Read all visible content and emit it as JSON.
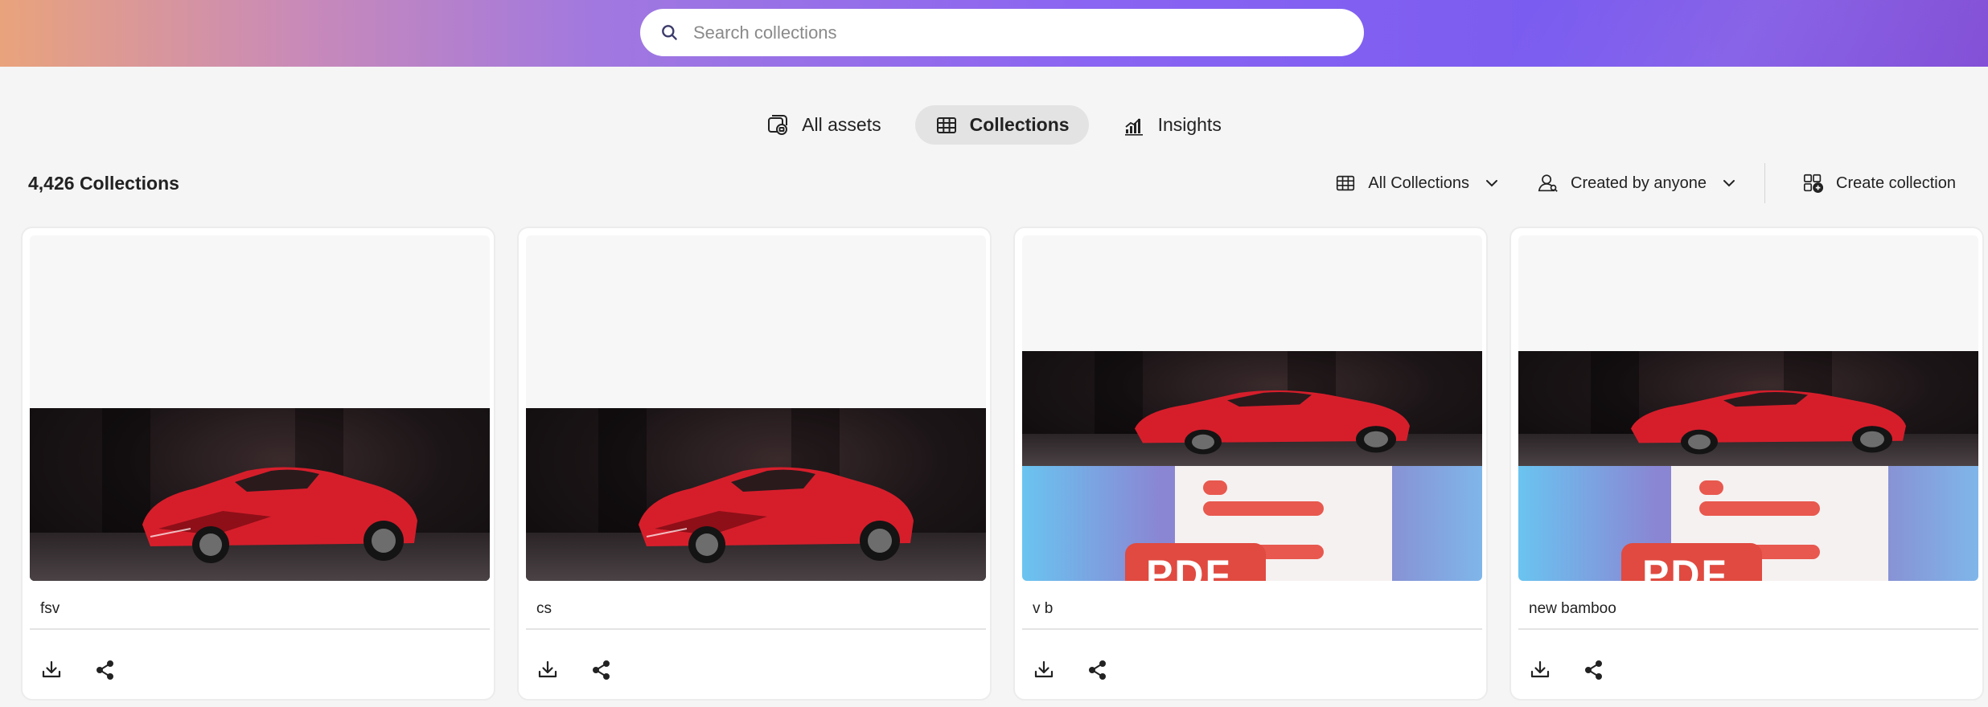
{
  "search": {
    "placeholder": "Search collections"
  },
  "tabs": [
    {
      "label": "All assets",
      "icon": "assets-icon",
      "active": false
    },
    {
      "label": "Collections",
      "icon": "grid-icon",
      "active": true
    },
    {
      "label": "Insights",
      "icon": "bar-chart-icon",
      "active": false
    }
  ],
  "toolbar": {
    "count": "4,426 Collections",
    "filter_type": "All Collections",
    "filter_creator": "Created by anyone",
    "create_label": "Create collection"
  },
  "cards": [
    {
      "name": "fsv",
      "thumbnail": "car"
    },
    {
      "name": "cs",
      "thumbnail": "car"
    },
    {
      "name": "v b",
      "thumbnail": "car-and-pdf",
      "pdf_badge": "PDF"
    },
    {
      "name": "new bamboo",
      "thumbnail": "car-and-pdf",
      "pdf_badge": "PDF"
    }
  ],
  "colors": {
    "accent_gradient_start": "#e9a37c",
    "accent_gradient_end": "#8450d8",
    "tab_active_bg": "#e3e3e3",
    "car_red": "#d61e2b"
  }
}
